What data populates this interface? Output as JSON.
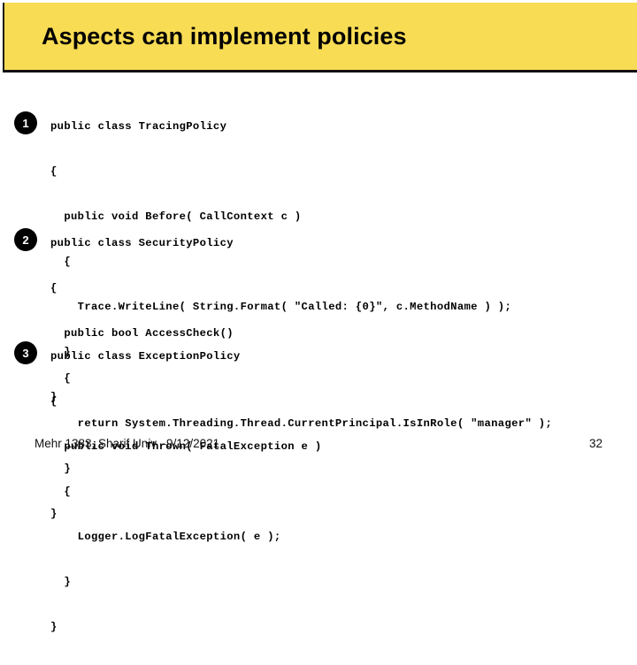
{
  "slide": {
    "title": "Aspects can implement policies",
    "banner_color": "#F8DC54",
    "banner_border_color": "#111111"
  },
  "code_blocks": [
    {
      "badge": "1",
      "language": "csharp",
      "lines": [
        "public class TracingPolicy",
        "{",
        "  public void Before( CallContext c )",
        "  {",
        "    Trace.WriteLine( String.Format( \"Called: {0}\", c.MethodName ) );",
        "  }",
        "}"
      ]
    },
    {
      "badge": "2",
      "language": "csharp",
      "lines": [
        "public class SecurityPolicy",
        "{",
        "  public bool AccessCheck()",
        "  {",
        "    return System.Threading.Thread.CurrentPrincipal.IsInRole( \"manager\" );",
        "  }",
        "}"
      ]
    },
    {
      "badge": "3",
      "language": "csharp",
      "lines": [
        "public class ExceptionPolicy",
        "{",
        "  public void Thrown( FatalException e )",
        "  {",
        "    Logger.LogFatalException( e );",
        "  }",
        "}"
      ]
    }
  ],
  "footer": {
    "left_text": "Mehr 1383, Sharif Univ. -9/12/2021",
    "page_number": "32"
  }
}
